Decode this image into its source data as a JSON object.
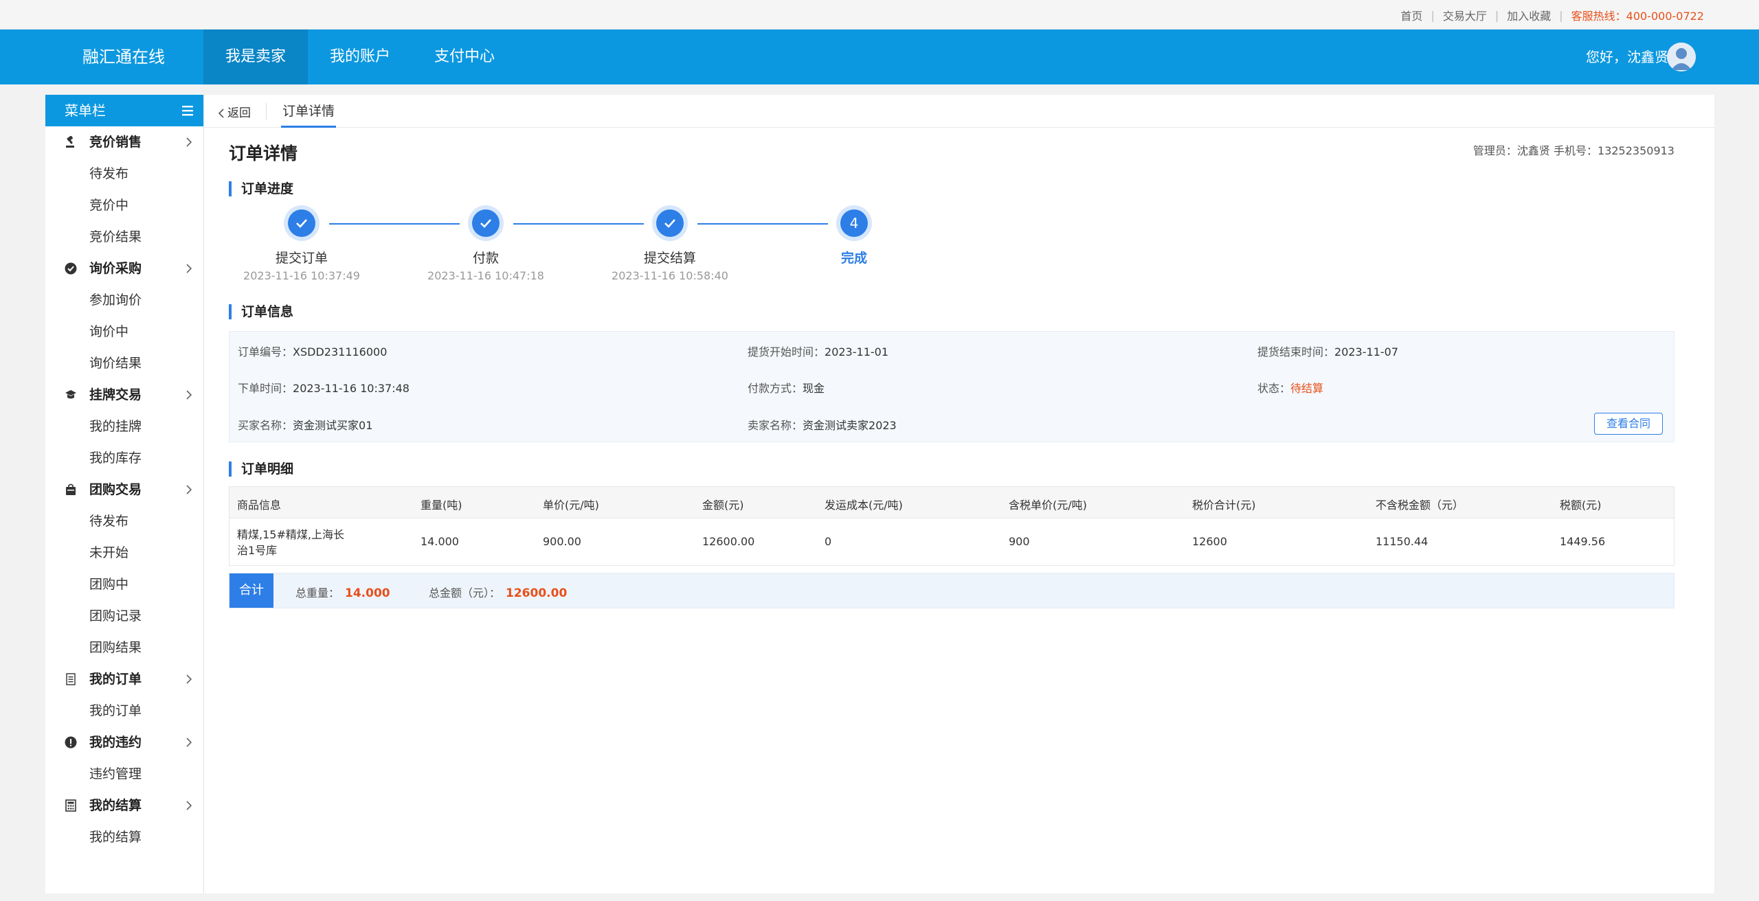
{
  "topbar": {
    "links": [
      "首页",
      "交易大厅",
      "加入收藏"
    ],
    "hotline": "客服热线：400-000-0722"
  },
  "header": {
    "logo": "融汇通在线",
    "nav": [
      "我是卖家",
      "我的账户",
      "支付中心"
    ],
    "active_nav": "我是卖家",
    "greeting": "您好，沈鑫贤"
  },
  "sidebar": {
    "title": "菜单栏",
    "groups": [
      {
        "label": "竞价销售",
        "icon": "gavel-icon",
        "items": [
          "待发布",
          "竞价中",
          "竞价结果"
        ]
      },
      {
        "label": "询价采购",
        "icon": "check-circle-icon",
        "items": [
          "参加询价",
          "询价中",
          "询价结果"
        ]
      },
      {
        "label": "挂牌交易",
        "icon": "graduation-cap-icon",
        "items": [
          "我的挂牌",
          "我的库存"
        ]
      },
      {
        "label": "团购交易",
        "icon": "bag-icon",
        "items": [
          "待发布",
          "未开始",
          "团购中",
          "团购记录",
          "团购结果"
        ]
      },
      {
        "label": "我的订单",
        "icon": "document-icon",
        "items": [
          "我的订单"
        ]
      },
      {
        "label": "我的违约",
        "icon": "exclamation-circle-icon",
        "items": [
          "违约管理"
        ]
      },
      {
        "label": "我的结算",
        "icon": "calculator-icon",
        "items": [
          "我的结算"
        ]
      }
    ]
  },
  "breadcrumb": {
    "back": "返回",
    "tab": "订单详情"
  },
  "page": {
    "title": "订单详情",
    "admin_info": "管理员：沈鑫贤  手机号：13252350913"
  },
  "progress": {
    "title": "订单进度",
    "steps": [
      {
        "label": "提交订单",
        "time": "2023-11-16 10:37:49",
        "done": true
      },
      {
        "label": "付款",
        "time": "2023-11-16 10:47:18",
        "done": true
      },
      {
        "label": "提交结算",
        "time": "2023-11-16 10:58:40",
        "done": true
      },
      {
        "label": "完成",
        "number": "4",
        "time": "",
        "done": false
      }
    ]
  },
  "order_info": {
    "title": "订单信息",
    "order_no_label": "订单编号：",
    "order_no": "XSDD231116000",
    "pickup_start_label": "提货开始时间：",
    "pickup_start": "2023-11-01",
    "pickup_end_label": "提货结束时间：",
    "pickup_end": "2023-11-07",
    "order_time_label": "下单时间：",
    "order_time": "2023-11-16 10:37:48",
    "payment_label": "付款方式：",
    "payment": "现金",
    "status_label": "状态：",
    "status": "待结算",
    "buyer_label": "买家名称：",
    "buyer": "资金测试买家01",
    "seller_label": "卖家名称：",
    "seller": "资金测试卖家2023",
    "contract_button": "查看合同",
    "status_color": "#e8501b"
  },
  "order_detail": {
    "title": "订单明细",
    "columns": [
      "商品信息",
      "重量(吨)",
      "单价(元/吨)",
      "金额(元)",
      "发运成本(元/吨)",
      "含税单价(元/吨)",
      "税价合计(元)",
      "不含税金额（元）",
      "税额(元)"
    ],
    "rows": [
      [
        "精煤,15#精煤,上海长治1号库",
        "14.000",
        "900.00",
        "12600.00",
        "0",
        "900",
        "12600",
        "11150.44",
        "1449.56"
      ]
    ],
    "summary": {
      "label": "合计",
      "total_weight_label": "总重量：",
      "total_weight": "14.000",
      "total_amount_label": "总金额（元）：",
      "total_amount": "12600.00"
    }
  },
  "colors": {
    "primary": "#0c98e0",
    "accent": "#2d7ee6",
    "warn": "#e8501b"
  }
}
